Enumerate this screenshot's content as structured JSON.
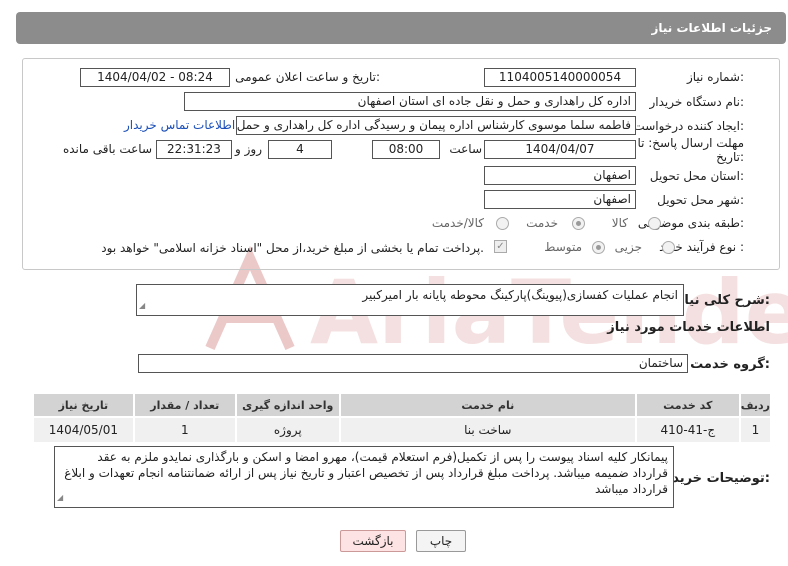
{
  "header": {
    "title": "جزئیات اطلاعات نیاز"
  },
  "form": {
    "need_number_label": "شماره نیاز:",
    "need_number": "1104005140000054",
    "announce_label": "تاریخ و ساعت اعلان عمومی:",
    "announce_value": "1404/04/02 - 08:24",
    "buyer_org_label": "نام دستگاه خریدار:",
    "buyer_org": "اداره کل راهداری و حمل و نقل جاده ای استان اصفهان",
    "requester_label": "ایجاد کننده درخواست:",
    "requester": "فاطمه سلما موسوی کارشناس اداره پیمان و رسیدگی اداره کل راهداری و حمل و نقل جاده ای استان اصفهان",
    "contact_link": "اطلاعات تماس خریدار",
    "deadline_label_1": "مهلت ارسال پاسخ: تا",
    "deadline_label_2": "تاریخ:",
    "deadline_date": "1404/04/07",
    "time_label": "ساعت",
    "deadline_time": "08:00",
    "days_value": "4",
    "days_label": "روز و",
    "remaining_time": "22:31:23",
    "remaining_label": "ساعت باقی مانده",
    "delivery_province_label": "استان محل تحویل:",
    "delivery_province": "اصفهان",
    "delivery_city_label": "شهر محل تحویل:",
    "delivery_city": "اصفهان",
    "category_label": "طبقه بندی موضوعی:",
    "category_options": [
      "کالا",
      "خدمت",
      "کالا/خدمت"
    ],
    "category_selected": "خدمت",
    "process_label": "نوع فرآیند خرید :",
    "process_options": [
      "جزیی",
      "متوسط"
    ],
    "process_selected": "متوسط",
    "payment_note": "پرداخت تمام یا بخشی از مبلغ خرید،از محل \"اسناد خزانه اسلامی\" خواهد بود."
  },
  "summary": {
    "label": "شرح کلی نیاز:",
    "text": "انجام عملیات کفسازی(پیوینگ)پارکینگ محوطه پایانه بار امیرکبیر"
  },
  "services": {
    "section_title": "اطلاعات خدمات مورد نیاز",
    "group_label": "گروه خدمت:",
    "group_value": "ساختمان",
    "columns": [
      "ردیف",
      "کد خدمت",
      "نام خدمت",
      "واحد اندازه گیری",
      "تعداد / مقدار",
      "تاریخ نیاز"
    ],
    "rows": [
      [
        "1",
        "ج-41-410",
        "ساخت بنا",
        "پروژه",
        "1",
        "1404/05/01"
      ]
    ]
  },
  "buyer_notes": {
    "label": "توضیحات خریدار:",
    "text": "پیمانکار کلیه اسناد پیوست را پس از تکمیل(فرم استعلام قیمت)، مهرو امضا و اسکن و بارگذاری نمایدو ملزم به عقد قرارداد ضمیمه میباشد. پرداخت مبلغ قرارداد پس از تخصیص اعتبار و تاریخ نیاز پس از ارائه ضمانتنامه انجام تعهدات و ابلاغ قرارداد میباشد"
  },
  "buttons": {
    "print": "چاپ",
    "back": "بازگشت"
  },
  "watermark": {
    "text": "AriaTender.neT"
  },
  "colors": {
    "header_bg": "#8c8c8c",
    "link": "#1a4fb8",
    "watermark": "#e8c4c4"
  }
}
